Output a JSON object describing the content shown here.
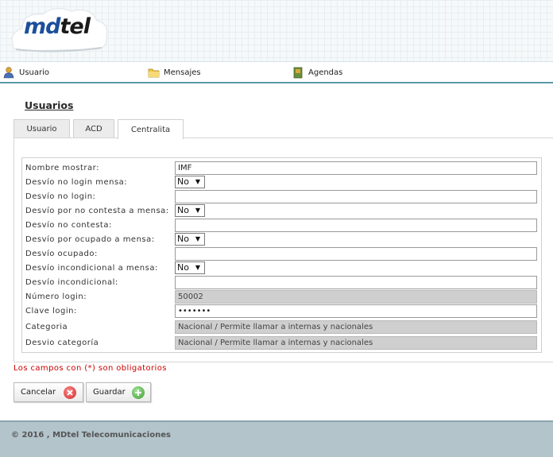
{
  "logo": {
    "md": "md",
    "tel": "tel"
  },
  "nav": [
    {
      "label": "Usuario",
      "icon": "user-icon"
    },
    {
      "label": "Mensajes",
      "icon": "folder-icon"
    },
    {
      "label": "Agendas",
      "icon": "book-icon"
    }
  ],
  "page_title": "Usuarios",
  "tabs": [
    "Usuario",
    "ACD",
    "Centralita"
  ],
  "active_tab": "Centralita",
  "form": {
    "rows": [
      {
        "label": "Nombre mostrar:",
        "type": "text",
        "value": "IMF"
      },
      {
        "label": "Desvío no login mensa:",
        "type": "select",
        "value": "No"
      },
      {
        "label": "Desvío no login:",
        "type": "text",
        "value": ""
      },
      {
        "label": "Desvío por no contesta a mensa:",
        "type": "select",
        "value": "No"
      },
      {
        "label": "Desvío no contesta:",
        "type": "text",
        "value": ""
      },
      {
        "label": "Desvío por ocupado a mensa:",
        "type": "select",
        "value": "No"
      },
      {
        "label": "Desvío ocupado:",
        "type": "text",
        "value": ""
      },
      {
        "label": "Desvío incondicional a mensa:",
        "type": "select",
        "value": "No"
      },
      {
        "label": "Desvío incondicional:",
        "type": "text",
        "value": ""
      },
      {
        "label": "Número login:",
        "type": "readonly",
        "value": "50002"
      },
      {
        "label": "Clave login:",
        "type": "password",
        "value": "•••••••"
      },
      {
        "label": "Categoria",
        "type": "readonly",
        "value": "Nacional / Permite llamar a internas y nacionales"
      },
      {
        "label": "Desvio categoría",
        "type": "readonly",
        "value": "Nacional / Permite llamar a internas y nacionales"
      }
    ]
  },
  "required_note": "Los campos con (*) son obligatorios",
  "buttons": {
    "cancel": "Cancelar",
    "save": "Guardar"
  },
  "footer": "© 2016 , MDtel Telecomunicaciones",
  "colors": {
    "accent": "#1b4f9c",
    "error": "#cc0000",
    "footer_bg": "#b3c4cb",
    "nav_border": "#5b9aa8"
  }
}
